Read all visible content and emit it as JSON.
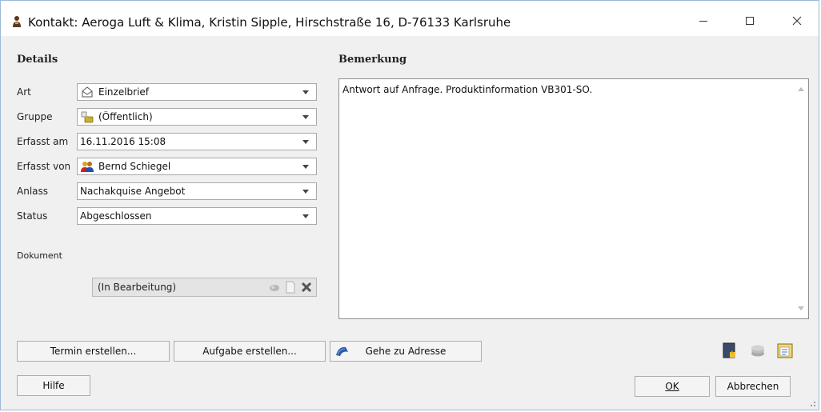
{
  "window": {
    "title": "Kontakt: Aeroga Luft & Klima, Kristin Sipple, Hirschstraße 16, D-76133 Karlsruhe",
    "icons": {
      "app": "person-icon",
      "minimize": "minimize-icon",
      "maximize": "maximize-icon",
      "close": "close-icon"
    }
  },
  "details": {
    "heading": "Details",
    "fields": [
      {
        "label": "Art",
        "value": "Einzelbrief",
        "icon": "envelope-icon"
      },
      {
        "label": "Gruppe",
        "value": "(Öffentlich)",
        "icon": "group-folder-icon"
      },
      {
        "label": "Erfasst am",
        "value": "16.11.2016 15:08",
        "icon": ""
      },
      {
        "label": "Erfasst von",
        "value": "Bernd Schiegel",
        "icon": "users-icon"
      },
      {
        "label": "Anlass",
        "value": "Nachakquise Angebot",
        "icon": ""
      },
      {
        "label": "Status",
        "value": "Abgeschlossen",
        "icon": ""
      }
    ],
    "document_label": "Dokument",
    "document_value": "(In Bearbeitung)",
    "document_icons": [
      "open-icon",
      "page-icon",
      "delete-icon"
    ]
  },
  "remark": {
    "heading": "Bemerkung",
    "text": "Antwort auf Anfrage. Produktinformation VB301-SO."
  },
  "actions": {
    "termin": "Termin erstellen...",
    "aufgabe": "Aufgabe erstellen...",
    "gehe": "Gehe zu Adresse",
    "tool_icons": [
      "note-icon",
      "coins-icon",
      "calendar-icon"
    ]
  },
  "footer": {
    "help": "Hilfe",
    "ok": "OK",
    "cancel": "Abbrechen"
  },
  "colors": {
    "border": "#9bb8d8",
    "background": "#f0f0f0",
    "field_border": "#a9a9a9"
  }
}
